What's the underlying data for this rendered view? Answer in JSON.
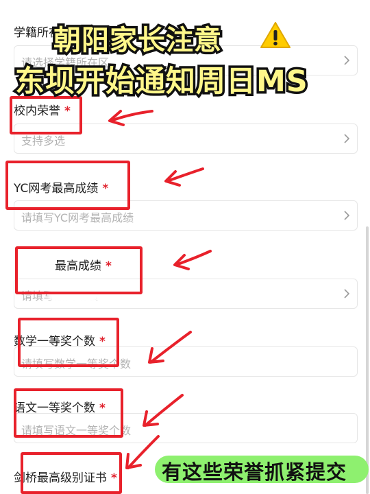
{
  "title": {
    "line1": "朝阳家长注意",
    "line2": "东坝开始通知周日MS",
    "icon": "warning-icon"
  },
  "form": {
    "fields": [
      {
        "label": "学籍所在区",
        "required": false,
        "placeholder": "请选择学籍所在区"
      },
      {
        "label": "校内荣誉",
        "required": true,
        "placeholder": "支持多选"
      },
      {
        "label": "YC网考最高成绩",
        "required": true,
        "placeholder": "请填写YC网考最高成绩"
      },
      {
        "label": "最高成绩",
        "required": true,
        "placeholder": "请填写最高成绩"
      },
      {
        "label": "数学一等奖个数",
        "required": true,
        "placeholder": "请填写数学一等奖个数"
      },
      {
        "label": "语文一等奖个数",
        "required": true,
        "placeholder": "请填写语文一等奖个数"
      },
      {
        "label": "剑桥最高级别证书",
        "required": true,
        "placeholder": ""
      }
    ],
    "required_mark": "*"
  },
  "banner": {
    "text": "有这些荣誉抓紧提交"
  },
  "colors": {
    "annotation_red": "#e8212b",
    "required_red": "#e0232e",
    "title_yellow": "#fff78a",
    "banner_green": "#8ef06f"
  }
}
